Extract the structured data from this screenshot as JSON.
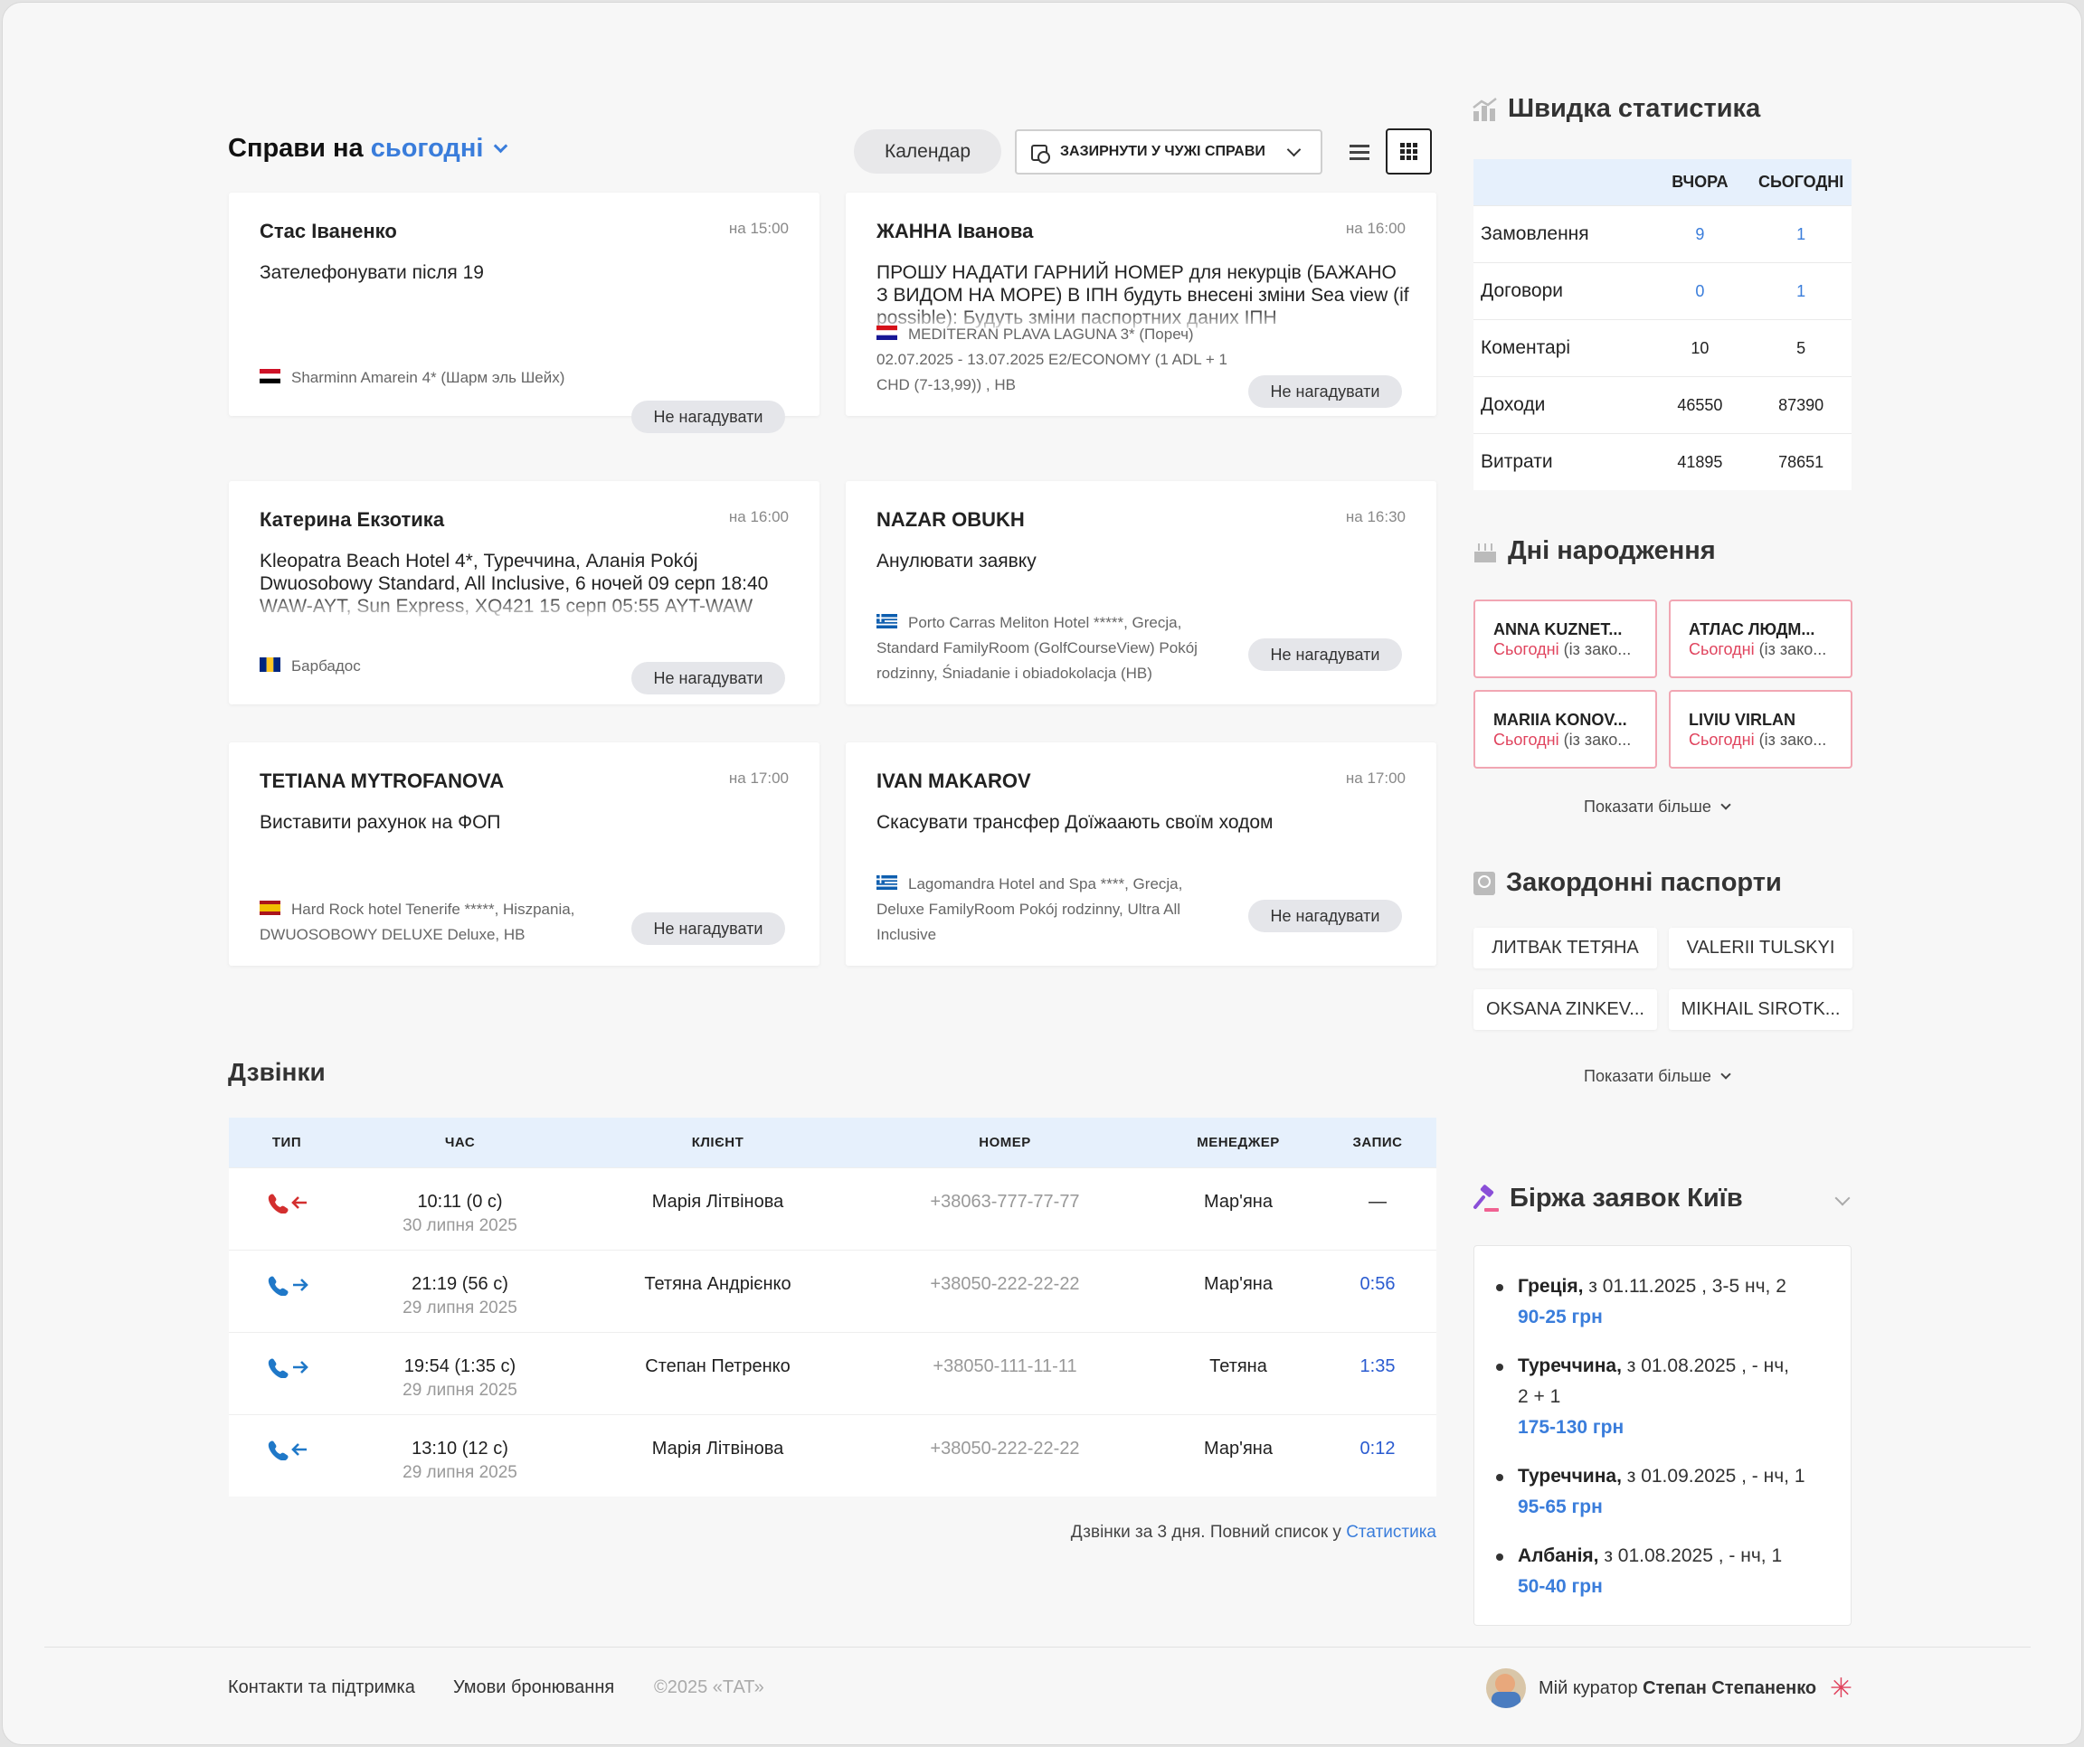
{
  "header": {
    "title_prefix": "Справи на",
    "title_period": "сьогодні",
    "calendar_btn": "Календар",
    "filter_select": "ЗАЗИРНУТИ У ЧУЖІ СПРАВИ"
  },
  "tasks": [
    {
      "name": "Стас Іваненко",
      "time": "на 15:00",
      "text": "Зателефонувати після 19",
      "hotel": "Sharminn Amarein 4* (Шарм эль Шейх)",
      "flag": "egypt",
      "action": "Не нагадувати"
    },
    {
      "name": "ЖАННА Іванова",
      "time": "на 16:00",
      "text": "ПРОШУ НАДАТИ ГАРНИЙ НОМЕР для некурців (БАЖАНО З ВИДОМ НА МОРЕ) В ІПН будуть внесені зміни Sea view (if possible): Будуть зміни паспортних даних ІПН",
      "hotel": "MEDITERAN PLAVA LAGUNA 3* (Пореч) 02.07.2025 - 13.07.2025 E2/ECONOMY (1 ADL + 1 CHD (7-13,99)) , HB",
      "flag": "croatia",
      "action": "Не нагадувати"
    },
    {
      "name": "Катерина Екзотика",
      "time": "на 16:00",
      "text": "Kleopatra Beach Hotel 4*, Туреччина, Аланія Pokój Dwuosobowy Standard, All Inclusive, 6 ночей 09 серп 18:40 WAW-AYT, Sun Express, XQ421 15 серп 05:55 AYT-WAW",
      "hotel": "Барбадос",
      "flag": "barbados",
      "action": "Не нагадувати"
    },
    {
      "name": "NAZAR OBUKH",
      "time": "на 16:30",
      "text": "Анулювати заявку",
      "hotel": "Porto Carras Meliton Hotel *****, Grecja, Standard FamilyRoom (GolfCourseView) Pokój rodzinny, Śniadanie i obiadokolacja (HB)",
      "flag": "greece",
      "action": "Не нагадувати"
    },
    {
      "name": "TETIANA MYTROFANOVA",
      "time": "на 17:00",
      "text": "Виставити рахунок на ФОП",
      "hotel": "Hard Rock hotel Tenerife *****, Hiszpania, DWUOSOBOWY DELUXE Deluxe, HB",
      "flag": "spain",
      "action": "Не нагадувати"
    },
    {
      "name": "IVAN MAKAROV",
      "time": "на 17:00",
      "text": "Скасувати трансфер Доїжаають своїм ходом",
      "hotel": "Lagomandra Hotel and Spa ****, Grecja, Deluxe FamilyRoom Pokój rodzinny, Ultra All Inclusive",
      "flag": "greece",
      "action": "Не нагадувати"
    }
  ],
  "calls": {
    "title": "Дзвінки",
    "columns": [
      "ТИП",
      "ЧАС",
      "КЛІЄНТ",
      "НОМЕР",
      "МЕНЕДЖЕР",
      "ЗАПИС"
    ],
    "rows": [
      {
        "type": "missed-incoming",
        "time": "10:11 (0 с)",
        "date": "30 липня 2025",
        "client": "Марія Літвінова",
        "phone": "+38063-777-77-77",
        "manager": "Мар'яна",
        "record": "—"
      },
      {
        "type": "outgoing",
        "time": "21:19 (56 с)",
        "date": "29 липня 2025",
        "client": "Тетяна Андрієнко",
        "phone": "+38050-222-22-22",
        "manager": "Мар'яна",
        "record": "0:56"
      },
      {
        "type": "outgoing",
        "time": "19:54 (1:35 с)",
        "date": "29 липня 2025",
        "client": "Степан Петренко",
        "phone": "+38050-111-11-11",
        "manager": "Тетяна",
        "record": "1:35"
      },
      {
        "type": "incoming",
        "time": "13:10 (12 с)",
        "date": "29 липня 2025",
        "client": "Марія Літвінова",
        "phone": "+38050-222-22-22",
        "manager": "Мар'яна",
        "record": "0:12"
      }
    ],
    "footer_text": "Дзвінки за 3 дня. Повний список у",
    "footer_link": "Статистика"
  },
  "stats": {
    "title": "Швидка статистика",
    "col_yesterday": "ВЧОРА",
    "col_today": "СЬОГОДНІ",
    "rows": [
      {
        "label": "Замовлення",
        "yesterday": "9",
        "today": "1"
      },
      {
        "label": "Договори",
        "yesterday": "0",
        "today": "1"
      },
      {
        "label": "Коментарі",
        "yesterday": "10",
        "today": "5"
      },
      {
        "label": "Доходи",
        "yesterday": "46550",
        "today": "87390"
      },
      {
        "label": "Витрати",
        "yesterday": "41895",
        "today": "78651"
      }
    ]
  },
  "birthdays": {
    "title": "Дні народження",
    "items": [
      {
        "name": "ANNA KUZNET...",
        "when": "Сьогодні",
        "note": " (із зако..."
      },
      {
        "name": "АТЛАС ЛЮДМ...",
        "when": "Сьогодні",
        "note": " (із зако..."
      },
      {
        "name": "MARIIA KONOV...",
        "when": "Сьогодні",
        "note": " (із зако..."
      },
      {
        "name": "LIVIU VIRLAN",
        "when": "Сьогодні",
        "note": " (із зако..."
      }
    ],
    "more": "Показати більше"
  },
  "passports": {
    "title": "Закордонні паспорти",
    "items": [
      "ЛИТВАК ТЕТЯНА",
      "VALERII TULSKYI",
      "OKSANA ZINKEV...",
      "MIKHAIL SIROTK..."
    ],
    "more": "Показати більше"
  },
  "exchange": {
    "title": "Біржа заявок Київ",
    "items": [
      {
        "country": "Греція,",
        "details": " з 01.11.2025 , 3-5 нч, 2",
        "price": "90-25 грн"
      },
      {
        "country": "Туреччина,",
        "details": " з 01.08.2025 , - нч, 2 + 1",
        "price": "175-130 грн"
      },
      {
        "country": "Туреччина,",
        "details": " з 01.09.2025 , - нч, 1",
        "price": "95-65 грн"
      },
      {
        "country": "Албанія,",
        "details": " з 01.08.2025 , - нч, 1",
        "price": "50-40 грн"
      }
    ]
  },
  "footer": {
    "contacts": "Контакти та підтримка",
    "terms": "Умови бронювання",
    "copyright": "©2025 «ТАТ»",
    "curator_label": "Мій куратор",
    "curator_name": "Степан Степаненко"
  },
  "colors": {
    "accent": "#3a7ddb",
    "missed": "#d32f2f",
    "birthday_border": "#f1a6b3",
    "birthday_today": "#e0445e"
  }
}
